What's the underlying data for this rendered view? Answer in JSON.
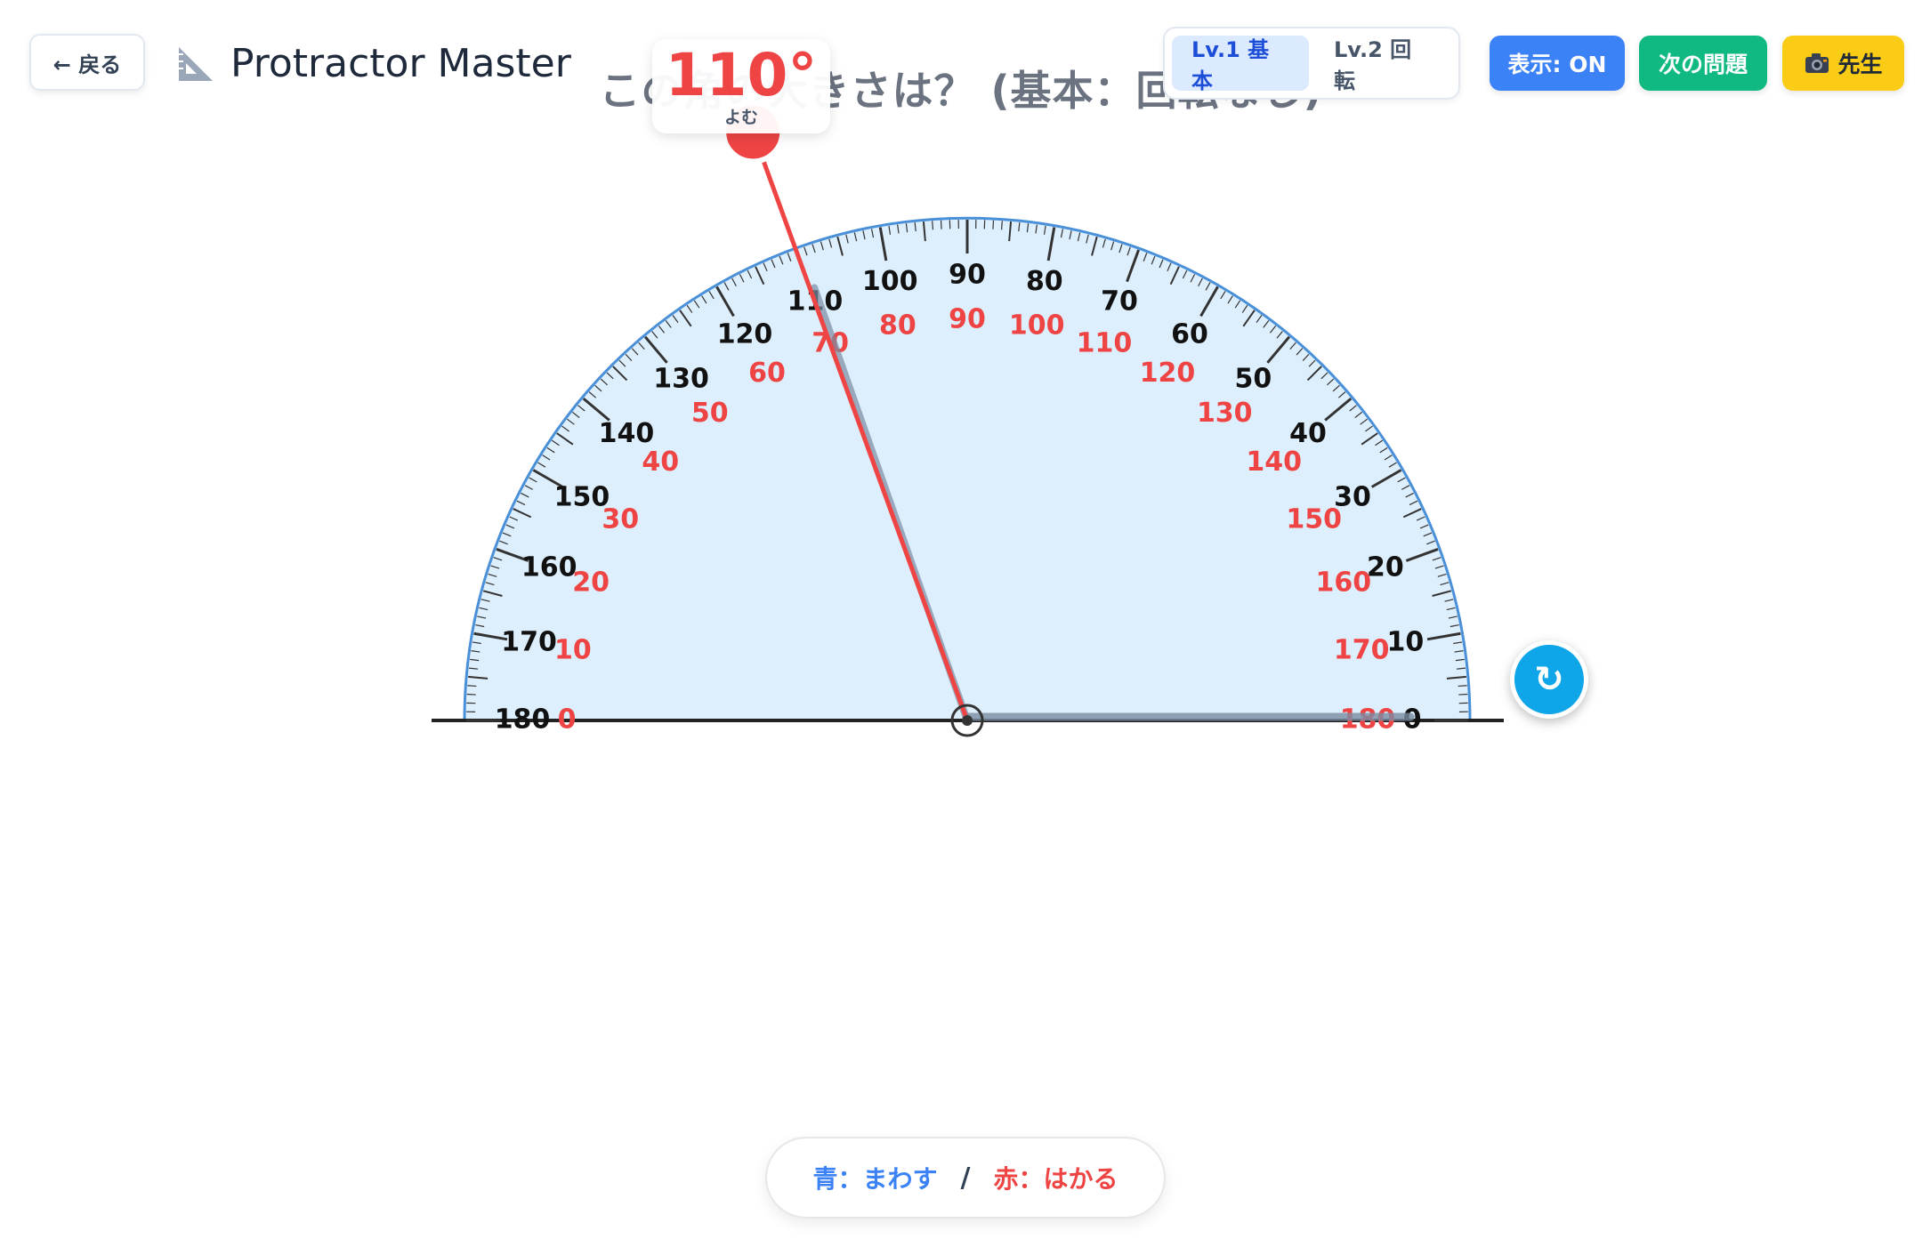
{
  "header": {
    "back_label": "← 戻る",
    "app_title": "Protractor Master",
    "question": "この角の大きさは？ (基本：回転なし)",
    "levels": [
      {
        "label": "Lv.1 基本",
        "active": true
      },
      {
        "label": "Lv.2 回転",
        "active": false
      }
    ],
    "display_label": "表示: ON",
    "next_label": "次の問題",
    "teacher_label": "先生",
    "teacher_icon": "camera-icon"
  },
  "readout": {
    "value": "110°",
    "caption": "よむ"
  },
  "protractor": {
    "measured_angle": 110,
    "outer_scale": [
      "180",
      "170",
      "160",
      "150",
      "140",
      "130",
      "120",
      "110",
      "100",
      "90",
      "80",
      "70",
      "60",
      "50",
      "40",
      "30",
      "20",
      "10",
      "0"
    ],
    "inner_scale": [
      "0",
      "10",
      "20",
      "30",
      "40",
      "50",
      "60",
      "70",
      "80",
      "90",
      "100",
      "110",
      "120",
      "130",
      "140",
      "150",
      "160",
      "170",
      "180"
    ],
    "rotate_icon": "rotate-icon"
  },
  "hint": {
    "blue": "青：まわす",
    "separator": "/",
    "red": "赤：はかる"
  },
  "colors": {
    "outer_scale": "#111111",
    "inner_scale": "#ef4444",
    "protractor_fill": "#ddeefc",
    "protractor_edge": "#4a90d9",
    "red_arm": "#ef4444",
    "accent_blue": "#3b82f6",
    "accent_green": "#10b981",
    "accent_yellow": "#facc15"
  }
}
